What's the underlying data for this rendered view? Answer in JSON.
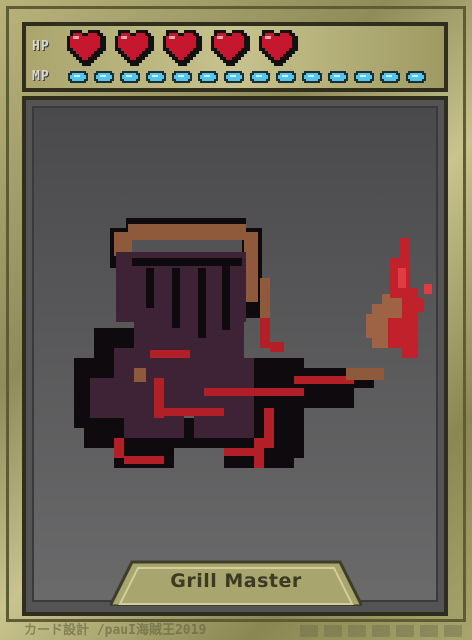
{
  "stats": {
    "hp_label": "HP",
    "mp_label": "MP",
    "hp": 5,
    "mp": 14
  },
  "card": {
    "name": "Grill Master",
    "credit": "カード設計 /pauI海賊王2019"
  },
  "colors": {
    "heart": "#c5182e",
    "mana": "#55c6ea",
    "frame": "#2f2e1e",
    "art_bg": "#5a595b",
    "gold": "#b8b27a"
  },
  "icons": {
    "hp": "heart-icon",
    "mp": "mana-pip-icon",
    "character": "grill-master-sprite"
  }
}
